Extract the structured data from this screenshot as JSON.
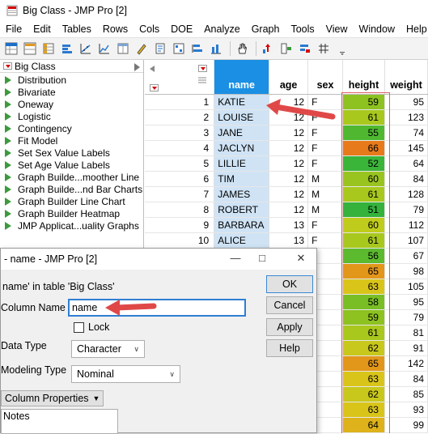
{
  "window": {
    "title": "Big Class - JMP Pro [2]"
  },
  "menu": [
    "File",
    "Edit",
    "Tables",
    "Rows",
    "Cols",
    "DOE",
    "Analyze",
    "Graph",
    "Tools",
    "View",
    "Window",
    "Help"
  ],
  "toolbar_icons": [
    "new-table-icon",
    "open-icon",
    "data-table-icon",
    "distribution-icon",
    "fit-y-by-x-icon",
    "graph-icon",
    "tabulate-icon",
    "journal-icon",
    "script-icon",
    "layout-icon",
    "subset-icon",
    "summary-icon",
    "hand-tool-icon",
    "fit-model-icon",
    "add-column-icon",
    "sort-icon",
    "grid-icon"
  ],
  "table_panel": {
    "title": "Big Class",
    "scripts": [
      "Distribution",
      "Bivariate",
      "Oneway",
      "Logistic",
      "Contingency",
      "Fit Model",
      "Set Sex Value Labels",
      "Set Age Value Labels",
      "Graph Builde...moother Line",
      "Graph Builde...nd Bar Charts",
      "Graph Builder Line Chart",
      "Graph Builder Heatmap",
      "JMP Applicat...uality Graphs"
    ]
  },
  "grid": {
    "columns": [
      "name",
      "age",
      "sex",
      "height",
      "weight"
    ],
    "rows": [
      {
        "n": "1",
        "name": "KATIE",
        "age": "12",
        "sex": "F",
        "height": "59",
        "weight": "95",
        "color": "#8dc220"
      },
      {
        "n": "2",
        "name": "LOUISE",
        "age": "12",
        "sex": "F",
        "height": "61",
        "weight": "123",
        "color": "#a8c81e"
      },
      {
        "n": "3",
        "name": "JANE",
        "age": "12",
        "sex": "F",
        "height": "55",
        "weight": "74",
        "color": "#4fb830"
      },
      {
        "n": "4",
        "name": "JACLYN",
        "age": "12",
        "sex": "F",
        "height": "66",
        "weight": "145",
        "color": "#e77a1b"
      },
      {
        "n": "5",
        "name": "LILLIE",
        "age": "12",
        "sex": "F",
        "height": "52",
        "weight": "64",
        "color": "#3bb43a"
      },
      {
        "n": "6",
        "name": "TIM",
        "age": "12",
        "sex": "M",
        "height": "60",
        "weight": "84",
        "color": "#99c41f"
      },
      {
        "n": "7",
        "name": "JAMES",
        "age": "12",
        "sex": "M",
        "height": "61",
        "weight": "128",
        "color": "#a8c81e"
      },
      {
        "n": "8",
        "name": "ROBERT",
        "age": "12",
        "sex": "M",
        "height": "51",
        "weight": "79",
        "color": "#34b23c"
      },
      {
        "n": "9",
        "name": "BARBARA",
        "age": "13",
        "sex": "F",
        "height": "60",
        "weight": "112",
        "color": "#bfcc1c"
      },
      {
        "n": "10",
        "name": "ALICE",
        "age": "13",
        "sex": "F",
        "height": "61",
        "weight": "107",
        "color": "#a8c81e"
      },
      {
        "n": "",
        "name": "",
        "age": "",
        "sex": "",
        "height": "56",
        "weight": "67",
        "color": "#5cba2e"
      },
      {
        "n": "",
        "name": "",
        "age": "",
        "sex": "",
        "height": "65",
        "weight": "98",
        "color": "#e2961a"
      },
      {
        "n": "",
        "name": "",
        "age": "",
        "sex": "",
        "height": "63",
        "weight": "105",
        "color": "#d9c51a"
      },
      {
        "n": "",
        "name": "",
        "age": "",
        "sex": "",
        "height": "58",
        "weight": "95",
        "color": "#79be24"
      },
      {
        "n": "",
        "name": "",
        "age": "",
        "sex": "",
        "height": "59",
        "weight": "79",
        "color": "#8dc220"
      },
      {
        "n": "",
        "name": "",
        "age": "",
        "sex": "",
        "height": "61",
        "weight": "81",
        "color": "#a8c81e"
      },
      {
        "n": "",
        "name": "",
        "age": "",
        "sex": "",
        "height": "62",
        "weight": "91",
        "color": "#c8c71c"
      },
      {
        "n": "",
        "name": "",
        "age": "",
        "sex": "",
        "height": "65",
        "weight": "142",
        "color": "#e2961a"
      },
      {
        "n": "",
        "name": "",
        "age": "",
        "sex": "",
        "height": "63",
        "weight": "84",
        "color": "#d9c51a"
      },
      {
        "n": "",
        "name": "",
        "age": "",
        "sex": "",
        "height": "62",
        "weight": "85",
        "color": "#c8c71c"
      },
      {
        "n": "",
        "name": "",
        "age": "",
        "sex": "",
        "height": "63",
        "weight": "93",
        "color": "#d9c51a"
      },
      {
        "n": "",
        "name": "",
        "age": "",
        "sex": "",
        "height": "64",
        "weight": "99",
        "color": "#ddb21a"
      }
    ]
  },
  "dialog": {
    "title": "- name - JMP Pro [2]",
    "subtitle": "name' in table 'Big Class'",
    "column_name_label": "Column Name",
    "column_name_value": "name",
    "lock_label": "Lock",
    "data_type_label": "Data Type",
    "data_type_value": "Character",
    "modeling_type_label": "Modeling Type",
    "modeling_type_value": "Nominal",
    "column_properties_label": "Column Properties",
    "notes_label": "Notes",
    "buttons": {
      "ok": "OK",
      "cancel": "Cancel",
      "apply": "Apply",
      "help": "Help"
    }
  },
  "colors": {
    "accent": "#1a8fe3",
    "annotation_arrow": "#e04848"
  }
}
